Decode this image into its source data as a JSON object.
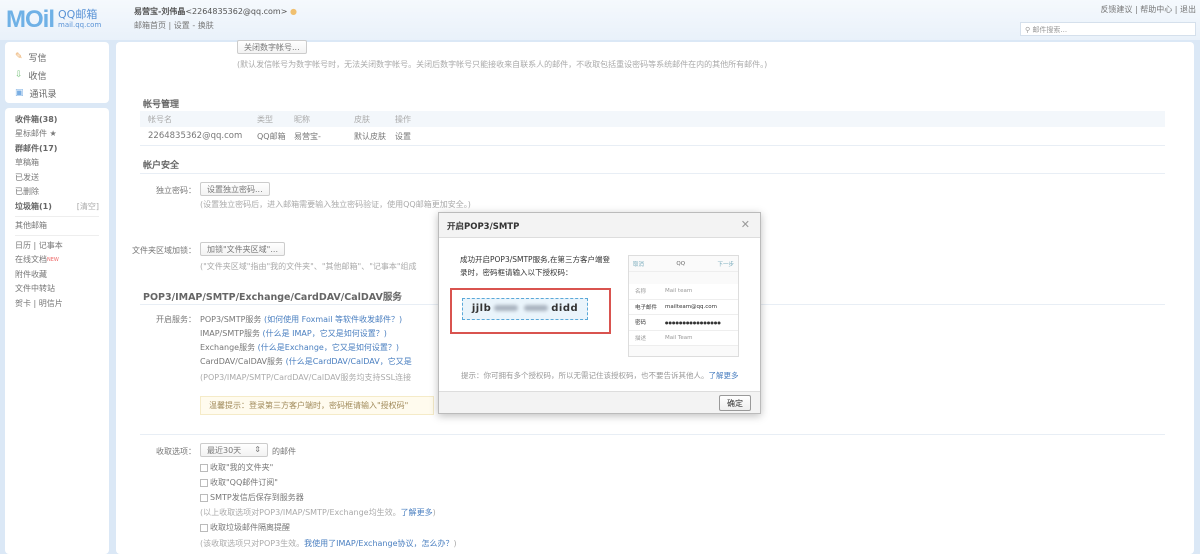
{
  "header": {
    "logo": "MOil",
    "logo_cn": "QQ邮箱",
    "logo_domain": "mail.qq.com",
    "user_name": "易营宝-刘伟晶",
    "user_email": "<2264835362@qq.com>",
    "links": [
      "邮箱首页",
      "设置",
      "换肤"
    ],
    "top_links": [
      "反馈建议",
      "帮助中心",
      "退出"
    ],
    "search_placeholder": "邮件搜索..."
  },
  "sidebar": {
    "actions": [
      "写信",
      "收信",
      "通讯录"
    ],
    "folders": [
      {
        "label": "收件箱(38)",
        "bold": true
      },
      {
        "label": "星标邮件 ★"
      },
      {
        "label": "群邮件(17)",
        "bold": true
      },
      {
        "label": "草稿箱"
      },
      {
        "label": "已发送"
      },
      {
        "label": "已删除"
      },
      {
        "label": "垃圾箱(1)",
        "bold": true,
        "extra": "[清空]"
      }
    ],
    "other": "其他邮箱",
    "tools": [
      "日历 | 记事本",
      "在线文档",
      "附件收藏",
      "文件中转站",
      "贺卡 | 明信片"
    ],
    "new_badge": "NEW"
  },
  "main": {
    "top_button": "关闭数字帐号...",
    "top_hint": "(默认发信帐号为数字帐号时，无法关闭数字帐号。关闭后数字帐号只能接收来自联系人的邮件，不收取包括重设密码等系统邮件在内的其他所有邮件。)",
    "account_title": "帐号管理",
    "account_cols": [
      "帐号名",
      "类型",
      "昵称",
      "皮肤",
      "操作"
    ],
    "account_row": [
      "2264835362@qq.com",
      "QQ邮箱",
      "易营宝-",
      "默认皮肤",
      "设置"
    ],
    "security_title": "帐户安全",
    "pwd_label": "独立密码：",
    "pwd_button": "设置独立密码...",
    "pwd_hint": "(设置独立密码后，进入邮箱需要输入独立密码验证，使用QQ邮箱更加安全。)",
    "folder_label": "文件夹区域加锁：",
    "folder_button": "加锁\"文件夹区域\"...",
    "folder_hint": "(\"文件夹区域\"指由\"我的文件夹\"、\"其他邮箱\"、\"记事本\"组成",
    "service_title": "POP3/IMAP/SMTP/Exchange/CardDAV/CalDAV服务",
    "service_label": "开启服务：",
    "services": [
      {
        "name": "POP3/SMTP服务",
        "help": "(如何使用 Foxmail 等软件收发邮件？)"
      },
      {
        "name": "IMAP/SMTP服务",
        "help": "(什么是 IMAP，它又是如何设置？)"
      },
      {
        "name": "Exchange服务",
        "help": "(什么是Exchange，它又是如何设置？)"
      },
      {
        "name": "CardDAV/CalDAV服务",
        "help": "(什么是CardDAV/CalDAV，它又是"
      }
    ],
    "ssl_hint": "(POP3/IMAP/SMTP/CardDAV/CalDAV服务均支持SSL连接",
    "warm_tip": "温馨提示：登录第三方客户端时，密码框请输入\"授权码\"",
    "recv_label": "收取选项：",
    "recv_select": "最近30天",
    "recv_suffix": "的邮件",
    "recv_options": [
      "收取\"我的文件夹\"",
      "收取\"QQ邮件订阅\"",
      "SMTP发信后保存到服务器"
    ],
    "recv_hint": "(以上收取选项对POP3/IMAP/SMTP/Exchange均生效。",
    "recv_hint_link": "了解更多",
    "spam_option": "收取垃圾邮件隔离提醒",
    "spam_hint": "(该收取选项只对POP3生效。",
    "spam_hint_link": "我使用了IMAP/Exchange协议，怎么办？"
  },
  "dialog": {
    "title": "开启POP3/SMTP",
    "message": "成功开启POP3/SMTP服务,在第三方客户端登录时，密码框请输入以下授权码：",
    "code_start": "jjlb",
    "code_end": "didd",
    "phone": {
      "cancel": "取消",
      "title": "QQ",
      "next": "下一步",
      "rows": [
        [
          "名称",
          "Mail team"
        ],
        [
          "电子邮件",
          "mailteam@qq.com"
        ],
        [
          "密码",
          "●●●●●●●●●●●●●●●●"
        ],
        [
          "描述",
          "Mail Team"
        ]
      ]
    },
    "tip": "提示：你可拥有多个授权码，所以无需记住该授权码，也不要告诉其他人。",
    "tip_link": "了解更多",
    "ok": "确定"
  }
}
